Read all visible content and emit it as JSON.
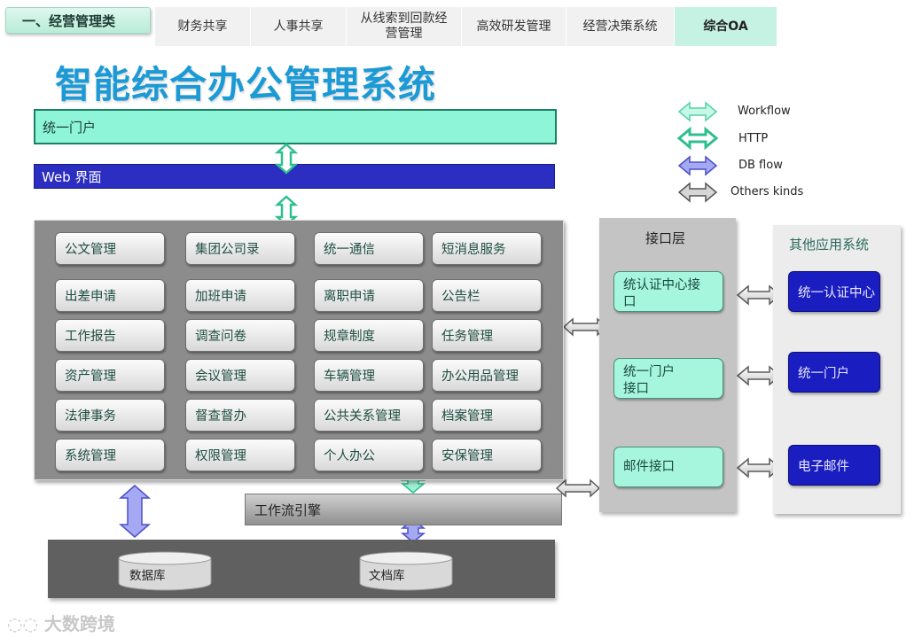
{
  "nav": {
    "section_label": "一、经营管理类",
    "tabs": [
      {
        "label": "财务共享",
        "active": false
      },
      {
        "label": "人事共享",
        "active": false
      },
      {
        "label": "从线索到回款经营管理",
        "active": false
      },
      {
        "label": "高效研发管理",
        "active": false
      },
      {
        "label": "经营决策系统",
        "active": false
      },
      {
        "label": "综合OA",
        "active": true
      }
    ]
  },
  "title": "智能综合办公管理系统",
  "portal_label": "统一门户",
  "web_label": "Web 界面",
  "legend": [
    {
      "label": "Workflow",
      "color": "#9ff0d2"
    },
    {
      "label": "HTTP",
      "color": "#5fe0b5"
    },
    {
      "label": "DB flow",
      "color": "#a5a8f2"
    },
    {
      "label": "Others kinds",
      "color": "#d6d6d6"
    }
  ],
  "modules": [
    [
      "公文管理",
      "集团公司录",
      "统一通信",
      "短消息服务"
    ],
    [
      "出差申请",
      "加班申请",
      "离职申请",
      "公告栏"
    ],
    [
      "工作报告",
      "调查问卷",
      "规章制度",
      "任务管理"
    ],
    [
      "资产管理",
      "会议管理",
      "车辆管理",
      "办公用品管理"
    ],
    [
      "法律事务",
      "督查督办",
      "公共关系管理",
      "档案管理"
    ],
    [
      "系统管理",
      "权限管理",
      "个人办公",
      "安保管理"
    ]
  ],
  "workflow_engine": "工作流引擎",
  "databases": {
    "db": "数据库",
    "docs": "文档库"
  },
  "interface_layer": {
    "title": "接口层",
    "items": [
      "统认证中心接口",
      "统一门户接口",
      "邮件接口"
    ]
  },
  "other_apps": {
    "title": "其他应用系统",
    "items": [
      "统一认证中心",
      "统一门户",
      "电子邮件"
    ]
  },
  "watermark": "大数跨境",
  "colors": {
    "title": "#1b9ad6",
    "portal": "#8ef5d9",
    "web": "#2b2ec0",
    "module_panel": "#8c8c8c",
    "app_button": "#1a1dbf"
  }
}
